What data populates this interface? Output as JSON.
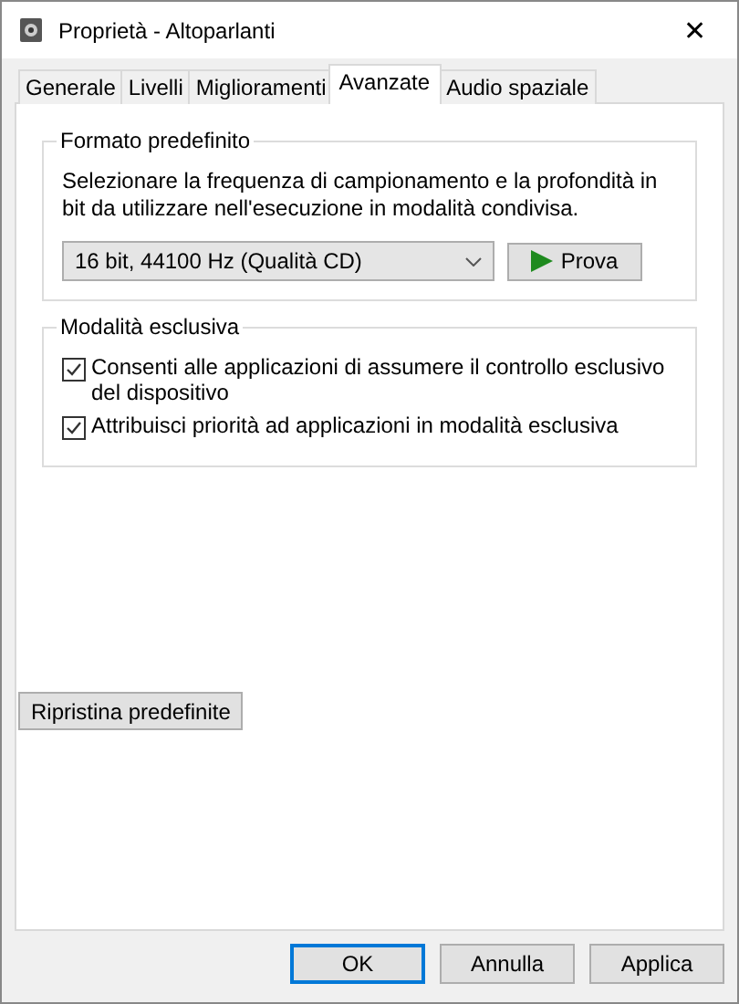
{
  "window": {
    "title": "Proprietà - Altoparlanti",
    "close": "✕"
  },
  "tabs": [
    {
      "label": "Generale",
      "selected": false
    },
    {
      "label": "Livelli",
      "selected": false
    },
    {
      "label": "Miglioramenti",
      "selected": false
    },
    {
      "label": "Avanzate",
      "selected": true
    },
    {
      "label": "Audio spaziale",
      "selected": false
    }
  ],
  "default_format": {
    "title": "Formato predefinito",
    "description": "Selezionare la frequenza di campionamento e la profondità in bit da utilizzare nell'esecuzione in modalità condivisa.",
    "format": "16 bit, 44100 Hz (Qualità CD)",
    "test_button": "Prova"
  },
  "exclusive_mode": {
    "title": "Modalità esclusiva",
    "options": [
      {
        "label": "Consenti alle applicazioni di assumere il controllo esclusivo del dispositivo",
        "checked": true
      },
      {
        "label": "Attribuisci priorità ad applicazioni in modalità esclusiva",
        "checked": true
      }
    ]
  },
  "restore_button": "Ripristina predefinite",
  "buttons": [
    {
      "label": "OK",
      "default": true
    },
    {
      "label": "Annulla",
      "default": false
    },
    {
      "label": "Applica",
      "default": false
    }
  ]
}
